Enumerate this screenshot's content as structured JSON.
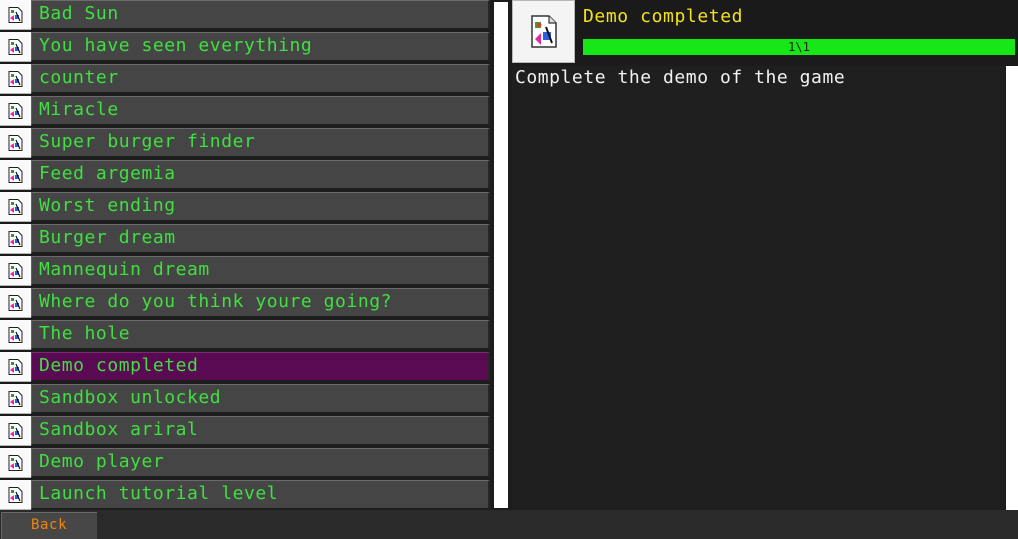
{
  "achievements": [
    {
      "name": "Bad Sun"
    },
    {
      "name": "You have seen everything"
    },
    {
      "name": "counter"
    },
    {
      "name": "Miracle"
    },
    {
      "name": "Super burger finder"
    },
    {
      "name": "Feed argemia"
    },
    {
      "name": "Worst ending"
    },
    {
      "name": "Burger dream"
    },
    {
      "name": "Mannequin dream"
    },
    {
      "name": "Where do you think youre going?"
    },
    {
      "name": "The hole"
    },
    {
      "name": "Demo completed",
      "selected": true
    },
    {
      "name": "Sandbox unlocked"
    },
    {
      "name": "Sandbox ariral"
    },
    {
      "name": "Demo player"
    },
    {
      "name": "Launch tutorial level"
    }
  ],
  "detail": {
    "title": "Demo completed",
    "progress_text": "1\\1",
    "progress_fraction": 1.0,
    "description": "Complete the demo of the game",
    "icon": "broken-image-icon"
  },
  "footer": {
    "back_label": "Back"
  },
  "colors": {
    "label_green": "#3fe03f",
    "selected_bg": "#5a0a52",
    "title_yellow": "#f4e21c",
    "progress_green": "#17e617",
    "back_orange": "#f0870a"
  }
}
